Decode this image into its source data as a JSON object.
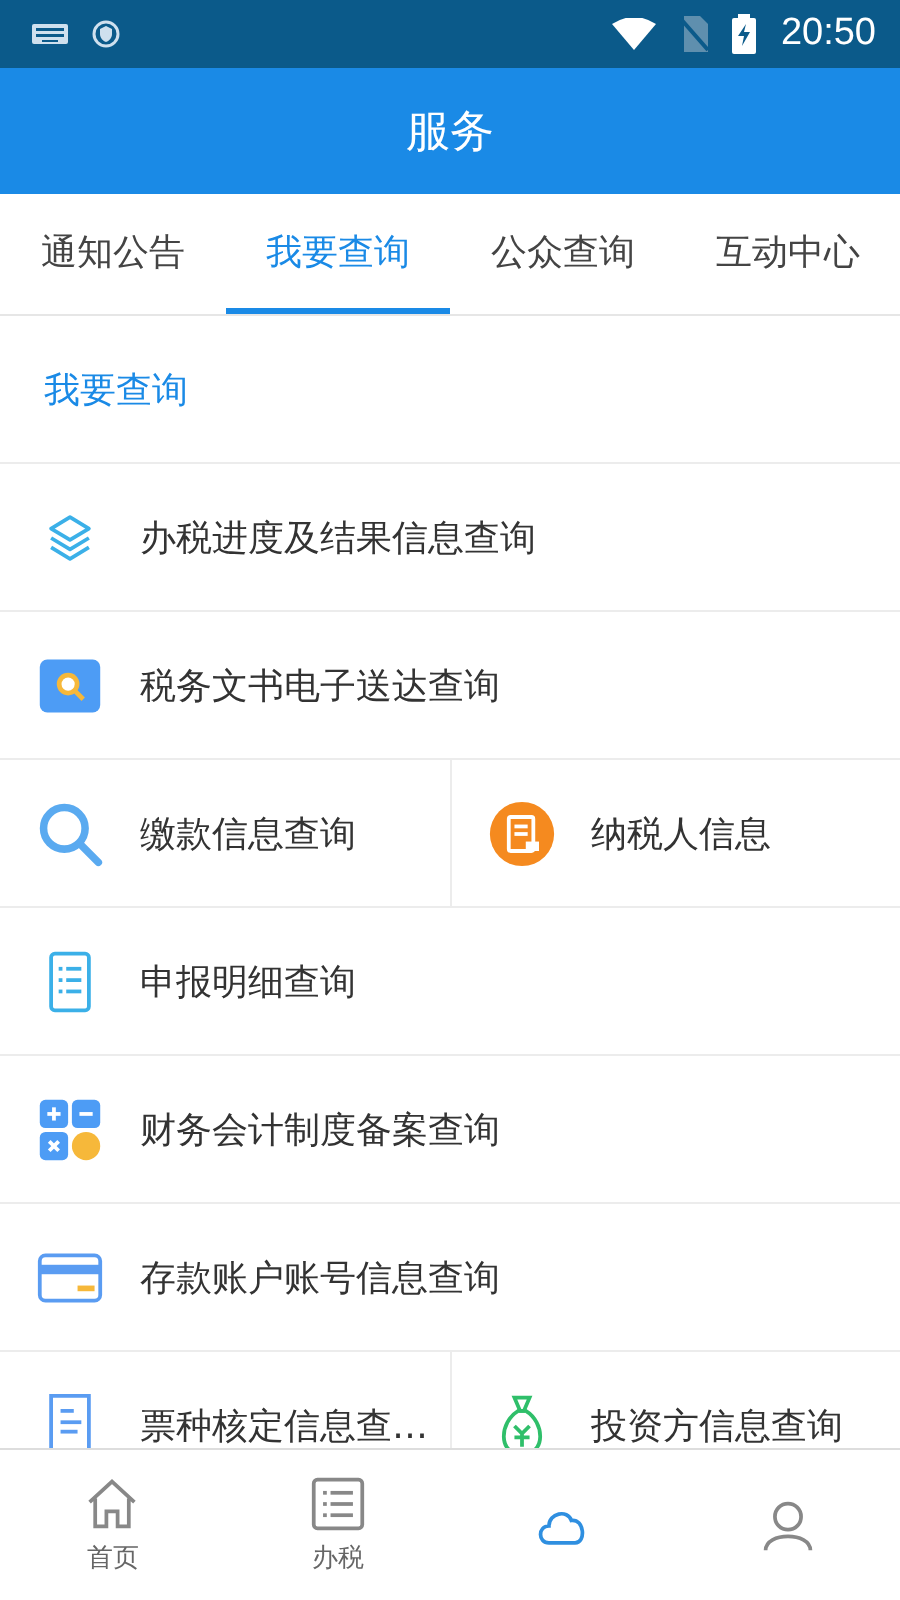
{
  "status_bar": {
    "time": "20:50"
  },
  "header": {
    "title": "服务"
  },
  "tabs": [
    {
      "label": "通知公告",
      "selected": false
    },
    {
      "label": "我要查询",
      "selected": true
    },
    {
      "label": "公众查询",
      "selected": false
    },
    {
      "label": "互动中心",
      "selected": false
    }
  ],
  "section": {
    "title": "我要查询"
  },
  "rows": [
    {
      "items": [
        {
          "label": "办税进度及结果信息查询",
          "kind": "layers"
        }
      ]
    },
    {
      "items": [
        {
          "label": "税务文书电子送达查询",
          "kind": "magnifier"
        }
      ]
    },
    {
      "items": [
        {
          "label": "缴款信息查询",
          "kind": "search"
        },
        {
          "label": "纳税人信息",
          "kind": "document"
        }
      ]
    },
    {
      "items": [
        {
          "label": "申报明细查询",
          "kind": "list"
        }
      ]
    },
    {
      "items": [
        {
          "label": "财务会计制度备案查询",
          "kind": "calculator"
        }
      ]
    },
    {
      "items": [
        {
          "label": "存款账户账号信息查询",
          "kind": "card"
        }
      ]
    },
    {
      "items": [
        {
          "label": "票种核定信息查…",
          "kind": "receipt"
        },
        {
          "label": "投资方信息查询",
          "kind": "bag"
        }
      ]
    }
  ],
  "bottom_nav": [
    {
      "label": "首页",
      "kind": "home",
      "selected": false
    },
    {
      "label": "办税",
      "kind": "list",
      "selected": false
    },
    {
      "kind": "cloud",
      "selected": true
    },
    {
      "kind": "person",
      "selected": false
    }
  ]
}
